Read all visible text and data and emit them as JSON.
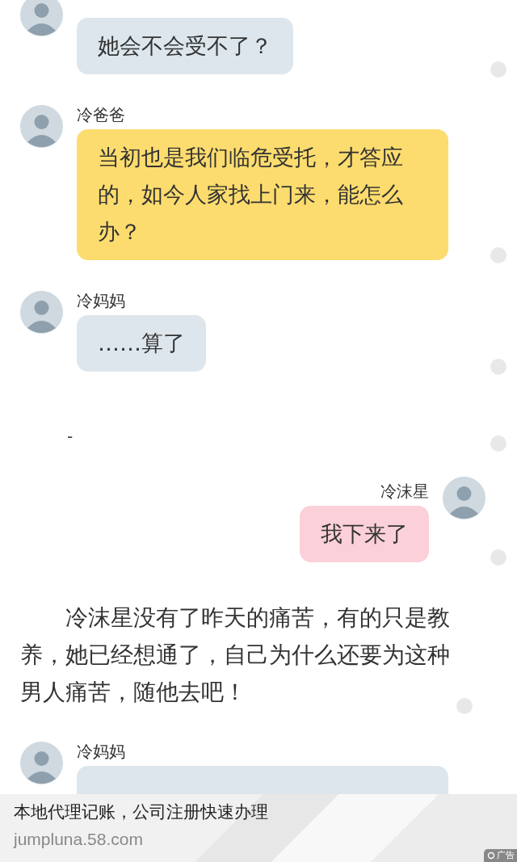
{
  "chat": [
    {
      "kind": "incoming",
      "color": "#dde6ec",
      "text": "她会不会受不了？"
    },
    {
      "kind": "incoming",
      "sender": "冷爸爸",
      "color": "#fcdc6e",
      "text": "当初也是我们临危受托，才答应的，如今人家找上门来，能怎么办？"
    },
    {
      "kind": "incoming",
      "sender": "冷妈妈",
      "color": "#dde6ec",
      "text": "……算了"
    },
    {
      "kind": "separator",
      "text": "-"
    },
    {
      "kind": "outgoing",
      "sender": "冷沫星",
      "color": "#fcd0d8",
      "text": "我下来了"
    },
    {
      "kind": "narration",
      "text": "冷沫星没有了昨天的痛苦，有的只是教养，她已经想通了，自己为什么还要为这种男人痛苦，随他去吧！"
    },
    {
      "kind": "incoming",
      "sender": "冷妈妈",
      "color": "#dde6ec"
    }
  ],
  "ad": {
    "title": "本地代理记账，公司注册快速办理",
    "url": "jumpluna.58.com",
    "badge": "广告"
  }
}
